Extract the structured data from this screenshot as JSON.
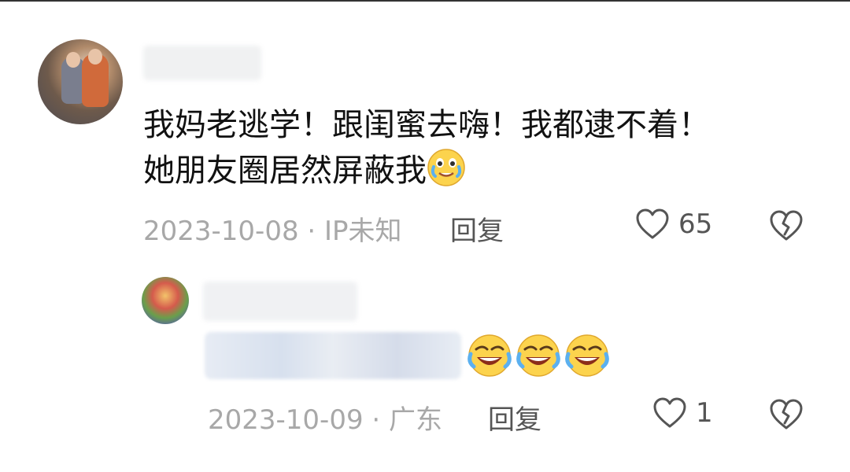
{
  "comment": {
    "text_line1": "我妈老逃学！跟闺蜜去嗨！我都逮不着！",
    "text_line2": "她朋友圈居然屏蔽我",
    "inline_emoji": "crying-laughing-emoji",
    "date": "2023-10-08",
    "location": "IP未知",
    "reply_label": "回复",
    "like_count": "65"
  },
  "reply": {
    "emojis": [
      "rolling-laughing-emoji",
      "rolling-laughing-emoji",
      "rolling-laughing-emoji"
    ],
    "date": "2023-10-09",
    "location": "广东",
    "reply_label": "回复",
    "like_count": "1"
  },
  "icons": {
    "like": "heart-outline-icon",
    "dislike": "broken-heart-icon"
  },
  "colors": {
    "text": "#111111",
    "meta": "#a8a8a8",
    "action": "#555555"
  }
}
